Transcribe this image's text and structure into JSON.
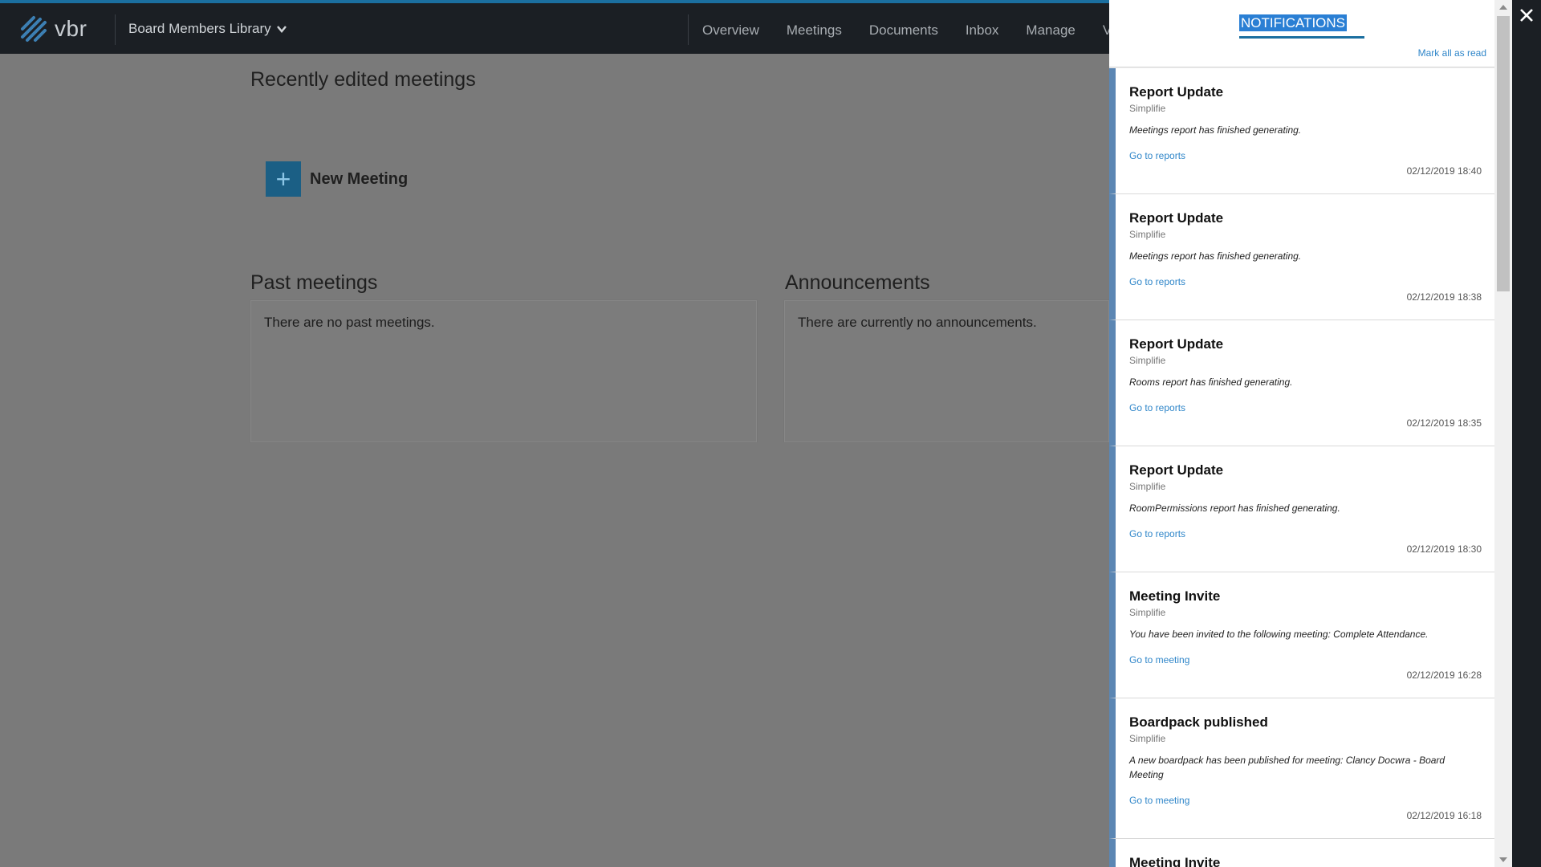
{
  "header": {
    "logo_text": "vbr",
    "library_label": "Board Members Library",
    "nav": [
      "Overview",
      "Meetings",
      "Documents",
      "Inbox",
      "Manage",
      "Vo"
    ]
  },
  "main": {
    "recent_heading": "Recently edited meetings",
    "new_meeting_label": "New Meeting",
    "past_heading": "Past meetings",
    "past_empty": "There are no past meetings.",
    "announcements_heading": "Announcements",
    "announcements_empty": "There are currently no announcements."
  },
  "notifications": {
    "title": "NOTIFICATIONS",
    "mark_all_read": "Mark all as read",
    "items": [
      {
        "title": "Report Update",
        "source": "Simplifie",
        "message": "Meetings report has finished generating.",
        "link": "Go to reports",
        "time": "02/12/2019 18:40"
      },
      {
        "title": "Report Update",
        "source": "Simplifie",
        "message": "Meetings report has finished generating.",
        "link": "Go to reports",
        "time": "02/12/2019 18:38"
      },
      {
        "title": "Report Update",
        "source": "Simplifie",
        "message": "Rooms report has finished generating.",
        "link": "Go to reports",
        "time": "02/12/2019 18:35"
      },
      {
        "title": "Report Update",
        "source": "Simplifie",
        "message": "RoomPermissions report has finished generating.",
        "link": "Go to reports",
        "time": "02/12/2019 18:30"
      },
      {
        "title": "Meeting Invite",
        "source": "Simplifie",
        "message": "You have been invited to the following meeting: Complete Attendance.",
        "link": "Go to meeting",
        "time": "02/12/2019 16:28"
      },
      {
        "title": "Boardpack published",
        "source": "Simplifie",
        "message": "A new boardpack has been published for meeting: Clancy Docwra - Board Meeting",
        "link": "Go to meeting",
        "time": "02/12/2019 16:18"
      },
      {
        "title": "Meeting Invite",
        "source": "",
        "message": "",
        "link": "",
        "time": ""
      }
    ]
  },
  "colors": {
    "topbar": "#1b1f24",
    "accent": "#1b6fa0",
    "link": "#2f86c9",
    "notif_border": "#5b86b3",
    "overlay": "#7a7a7a"
  },
  "icons": {
    "logo": "vbr-logo-icon",
    "library_chevron": "chevron-down-icon",
    "new_meeting": "plus-icon",
    "close": "close-icon"
  }
}
